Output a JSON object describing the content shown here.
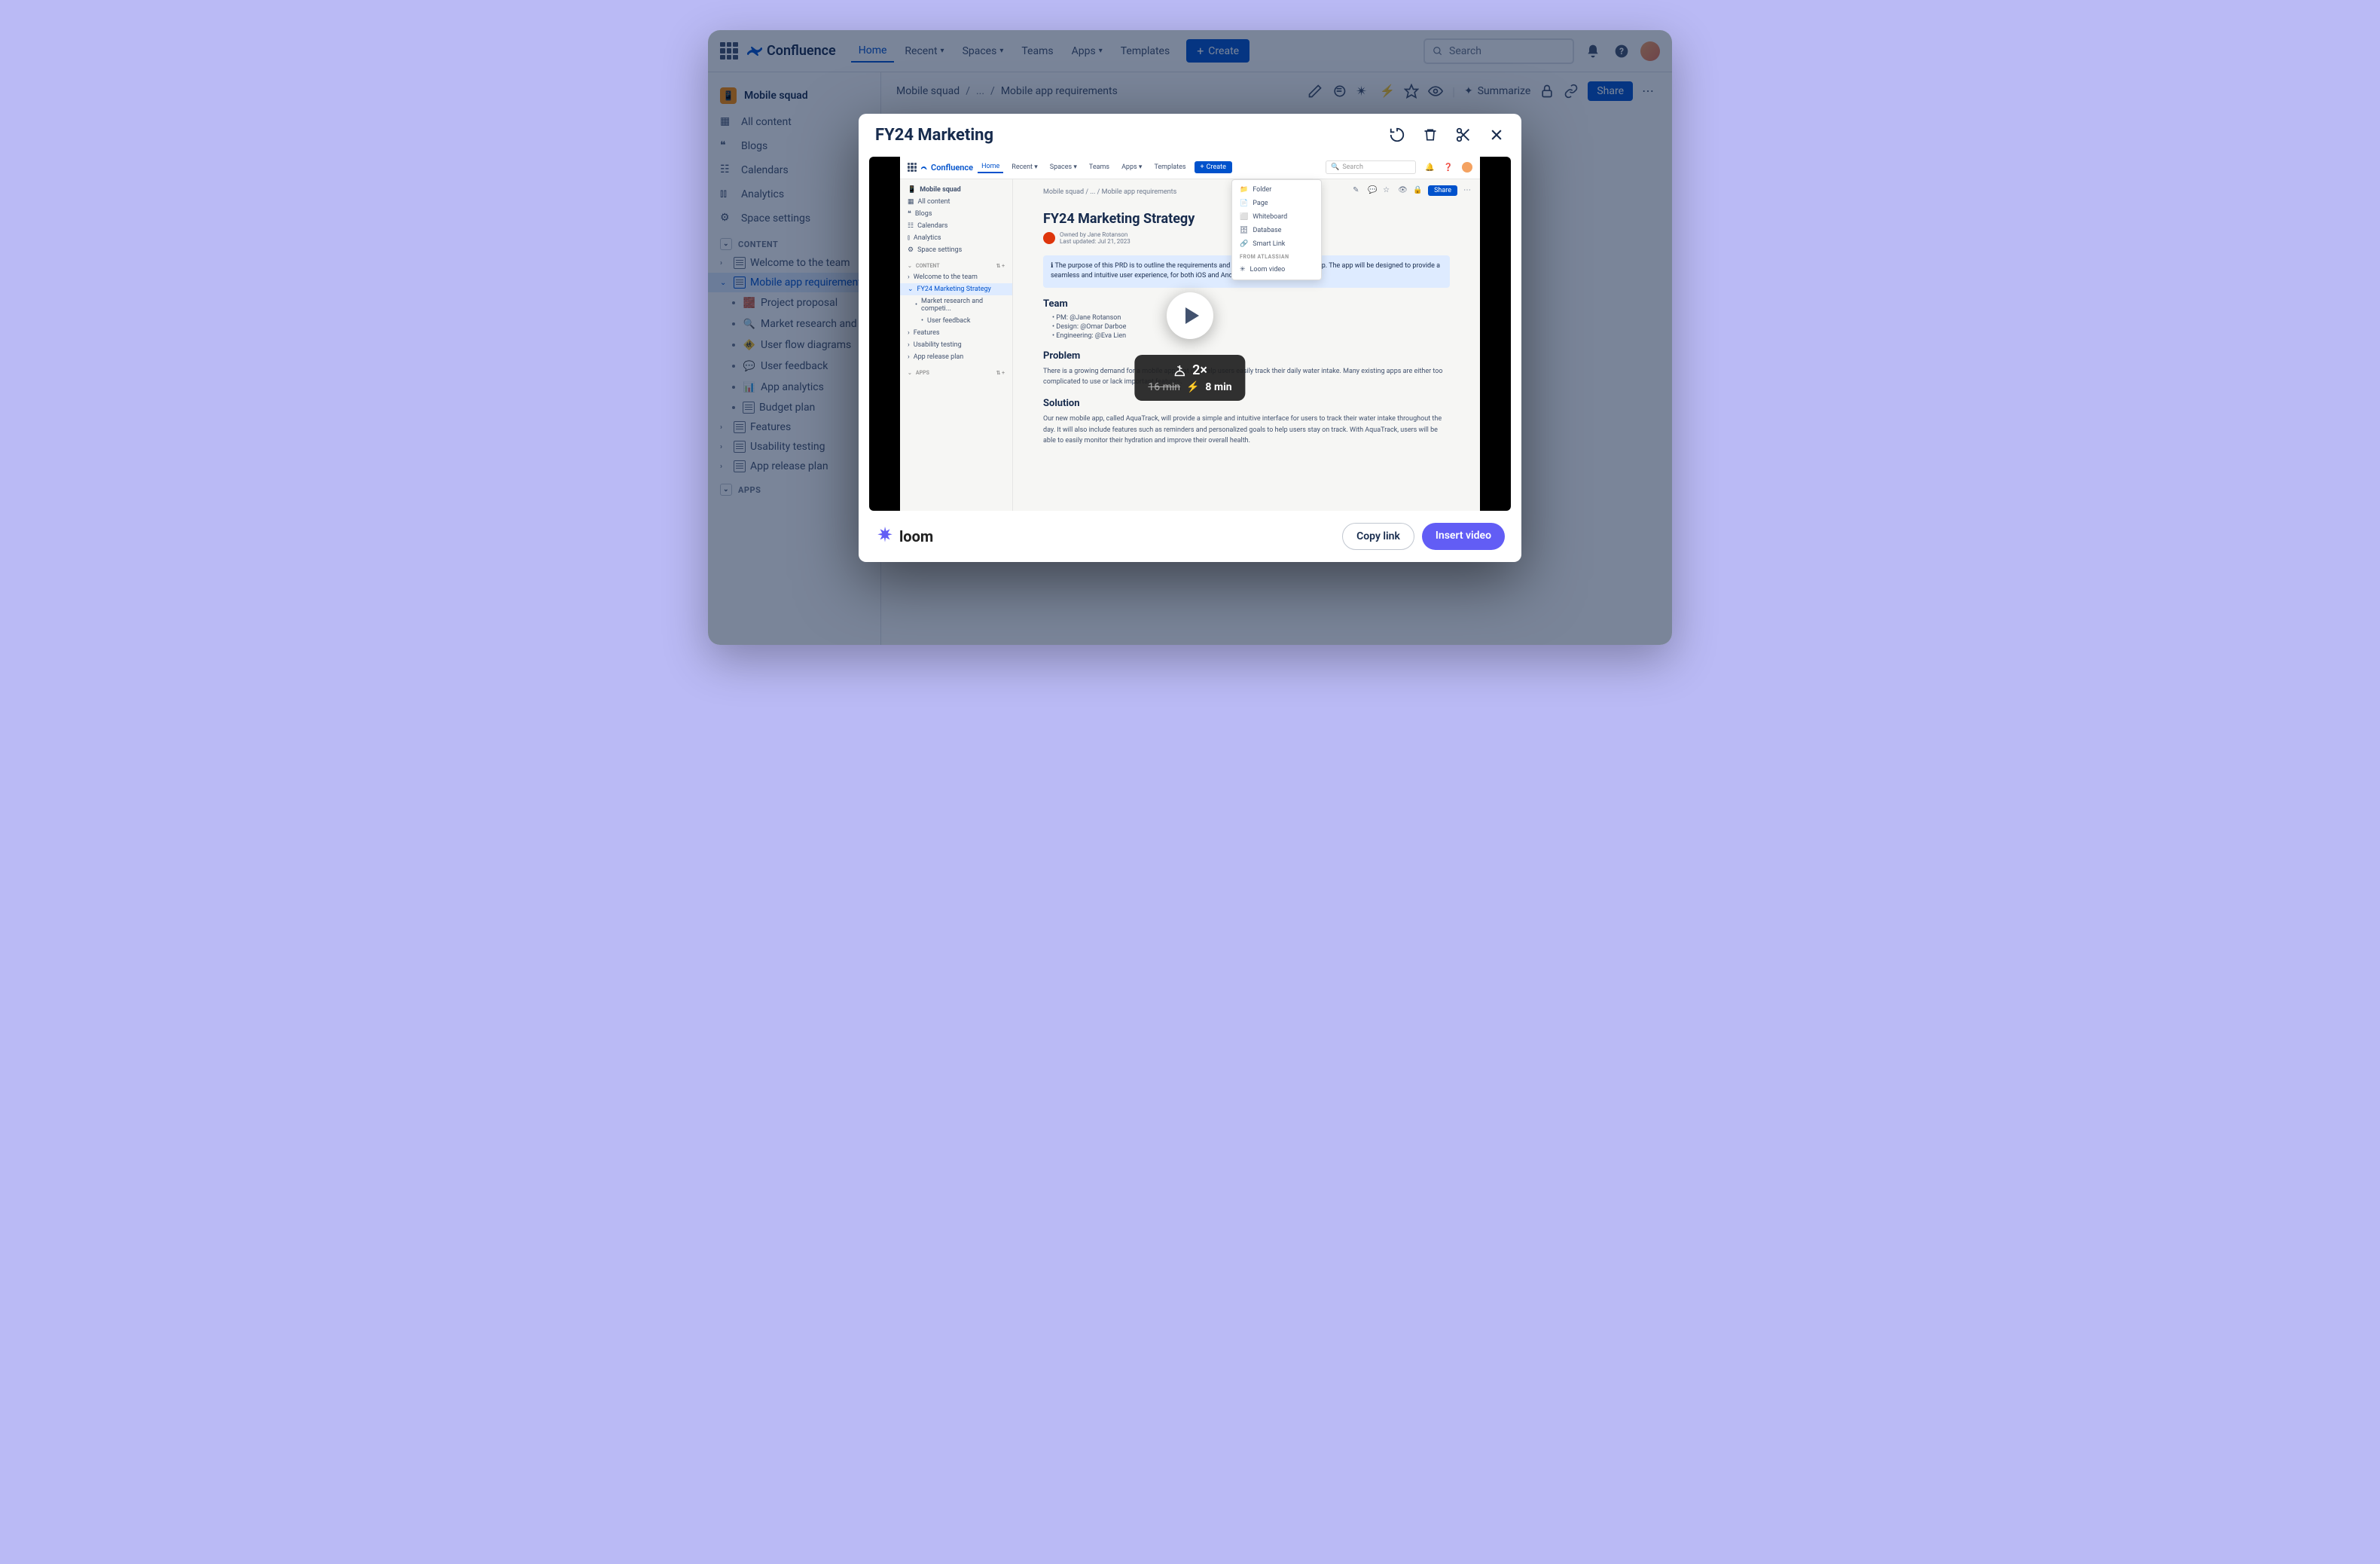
{
  "app": {
    "name": "Confluence"
  },
  "nav": {
    "home": "Home",
    "recent": "Recent",
    "spaces": "Spaces",
    "teams": "Teams",
    "apps": "Apps",
    "templates": "Templates",
    "create": "Create",
    "search_placeholder": "Search"
  },
  "space": {
    "name": "Mobile squad"
  },
  "sidebar": {
    "allcontent": "All content",
    "blogs": "Blogs",
    "calendars": "Calendars",
    "analytics": "Analytics",
    "settings": "Space settings",
    "content_hdr": "CONTENT",
    "apps_hdr": "APPS",
    "tree": {
      "welcome": "Welcome to the team",
      "reqs": "Mobile app requirements",
      "proposal": "Project proposal",
      "research": "Market research and competitive analysis",
      "flows": "User flow diagrams",
      "feedback": "User feedback",
      "analytics": "App analytics",
      "budget": "Budget plan",
      "features": "Features",
      "usability": "Usability testing",
      "release": "App release plan"
    }
  },
  "breadcrumb": {
    "space": "Mobile squad",
    "dots": "...",
    "page": "Mobile app requirements"
  },
  "page_actions": {
    "summarize": "Summarize",
    "share": "Share"
  },
  "modal": {
    "title": "FY24 Marketing",
    "speed": "2×",
    "old_time": "16 min",
    "new_time": "8 min",
    "copy": "Copy link",
    "insert": "Insert video",
    "loom": "loom"
  },
  "vf": {
    "nav": {
      "home": "Home",
      "recent": "Recent",
      "spaces": "Spaces",
      "teams": "Teams",
      "apps": "Apps",
      "templates": "Templates",
      "create": "Create",
      "search": "Search"
    },
    "crumb": "Mobile squad  /  ...  /  Mobile app requirements",
    "title": "FY24 Marketing Strategy",
    "owner": "Owned by Jane Rotanson",
    "updated": "Last updated: Jul 21, 2023",
    "info": "The purpose of this PRD is to outline the requirements and features of our new mobile app. The app will be designed to provide a seamless and intuitive user experience, for both iOS and Android.",
    "team_h": "Team",
    "team": [
      "PM:  @Jane Rotanson",
      "Design:  @Omar Darboe",
      "Engineering:  @Eva Lien"
    ],
    "problem_h": "Problem",
    "problem": "There is a growing demand for a mobile app that can help users easily track their daily water intake. Many existing apps are either too complicated to use or lack important features.",
    "solution_h": "Solution",
    "solution": "Our new mobile app, called AquaTrack, will provide a simple and intuitive interface for users to track their water intake throughout the day. It will also include features such as reminders and personalized goals to help users stay on track. With AquaTrack, users will be able to easily monitor their hydration and improve their overall health.",
    "menu": {
      "folder": "Folder",
      "page": "Page",
      "whiteboard": "Whiteboard",
      "database": "Database",
      "smartlink": "Smart Link",
      "from": "FROM ATLASSIAN",
      "loom": "Loom video"
    },
    "side": {
      "space": "Mobile squad",
      "all": "All content",
      "blogs": "Blogs",
      "cal": "Calendars",
      "ana": "Analytics",
      "set": "Space settings",
      "content": "CONTENT",
      "welcome": "Welcome to the team",
      "strategy": "FY24 Marketing Strategy",
      "research": "Market research and competi...",
      "feedback": "User feedback",
      "features": "Features",
      "usability": "Usability testing",
      "release": "App release plan",
      "apps": "APPS"
    },
    "share": "Share"
  }
}
